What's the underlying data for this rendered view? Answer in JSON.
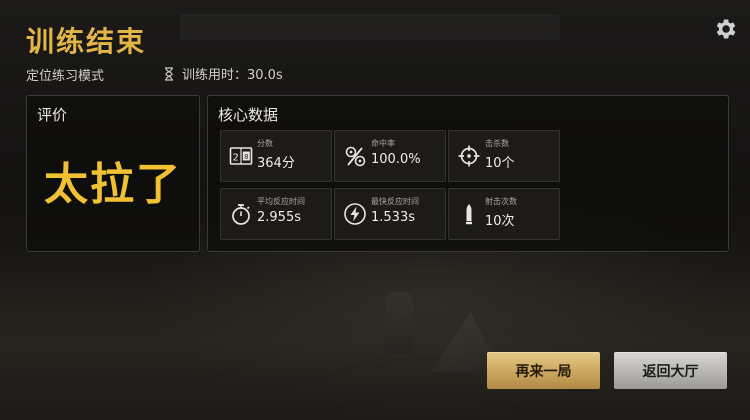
{
  "header": {
    "title": "训练结束",
    "mode": "定位练习模式",
    "time_label": "训练用时：30.0s"
  },
  "evaluation": {
    "panel_title": "评价",
    "verdict": "太拉了"
  },
  "core_data": {
    "panel_title": "核心数据",
    "stats": [
      {
        "label": "分数",
        "value": "364分",
        "icon": "scoreboard-icon"
      },
      {
        "label": "命中率",
        "value": "100.0%",
        "icon": "accuracy-icon"
      },
      {
        "label": "击杀数",
        "value": "10个",
        "icon": "crosshair-icon"
      },
      {
        "label": "平均反应时间",
        "value": "2.955s",
        "icon": "stopwatch-icon"
      },
      {
        "label": "最快反应时间",
        "value": "1.533s",
        "icon": "lightning-icon"
      },
      {
        "label": "射击次数",
        "value": "10次",
        "icon": "bullet-icon"
      }
    ]
  },
  "buttons": {
    "play_again": "再来一局",
    "return_lobby": "返回大厅"
  },
  "colors": {
    "accent_gold": "#e3b547",
    "verdict_gold": "#f0c233",
    "panel_bg": "#0e0d0c",
    "card_bg": "#1c1b1a"
  },
  "icons": {
    "settings": "gear-icon",
    "timer": "hourglass-icon"
  }
}
